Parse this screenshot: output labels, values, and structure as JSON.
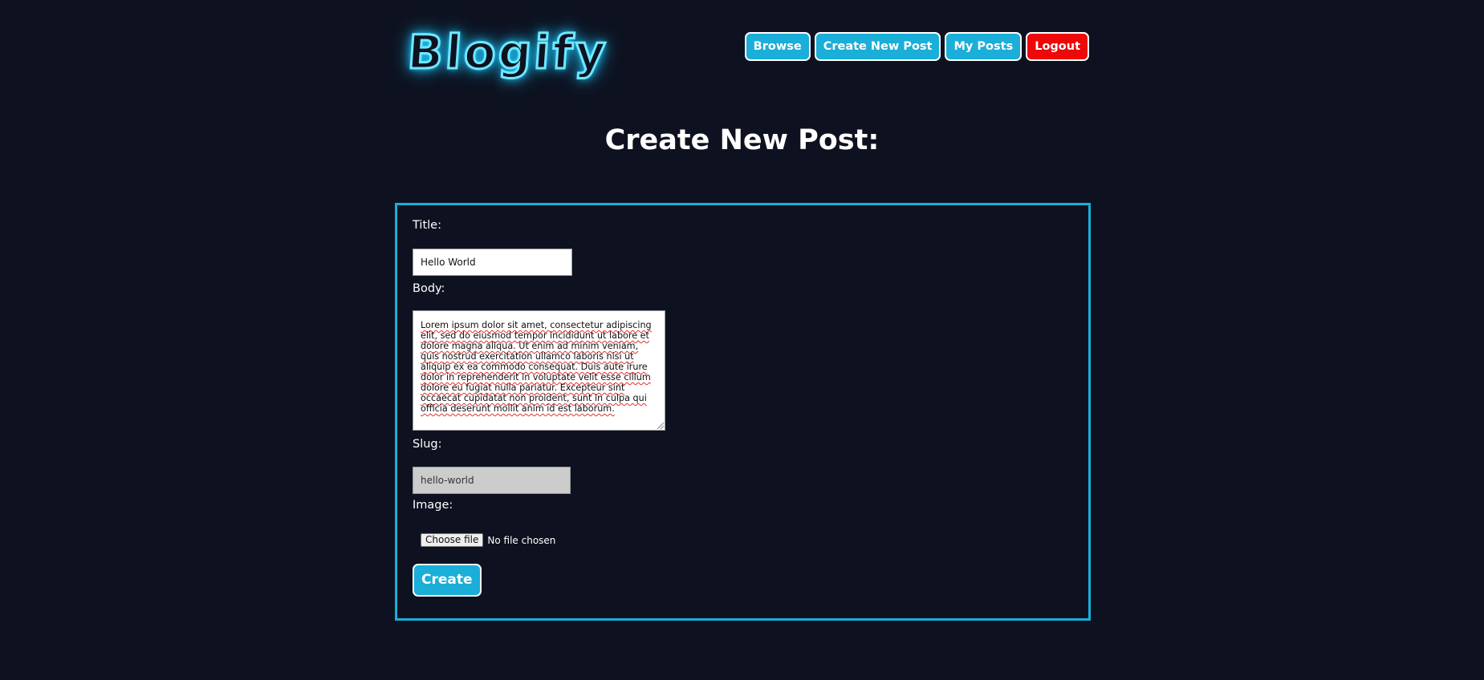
{
  "header": {
    "logo_text": "Blogify",
    "nav": {
      "browse": "Browse",
      "create_new_post": "Create New Post",
      "my_posts": "My Posts",
      "logout": "Logout"
    }
  },
  "main": {
    "page_title": "Create New Post:"
  },
  "form": {
    "title_label": "Title:",
    "title_value": "Hello World",
    "body_label": "Body:",
    "body_value": "Lorem ipsum dolor sit amet, consectetur adipiscing elit, sed do eiusmod tempor incididunt ut labore et dolore magna aliqua. Ut enim ad minim veniam, quis nostrud exercitation ullamco laboris nisi ut aliquip ex ea commodo consequat. Duis aute irure dolor in reprehenderit in voluptate velit esse cillum dolore eu fugiat nulla pariatur. Excepteur sint occaecat cupidatat non proident, sunt in culpa qui officia deserunt mollit anim id est laborum.",
    "slug_label": "Slug:",
    "slug_value": "hello-world",
    "image_label": "Image:",
    "file_button_label": "Choose file",
    "file_status": "No file chosen",
    "submit_label": "Create"
  },
  "colors": {
    "background": "#0e1220",
    "accent": "#1aaed8",
    "logout": "#ee0808",
    "logo_glow": "#1ec8ff"
  }
}
